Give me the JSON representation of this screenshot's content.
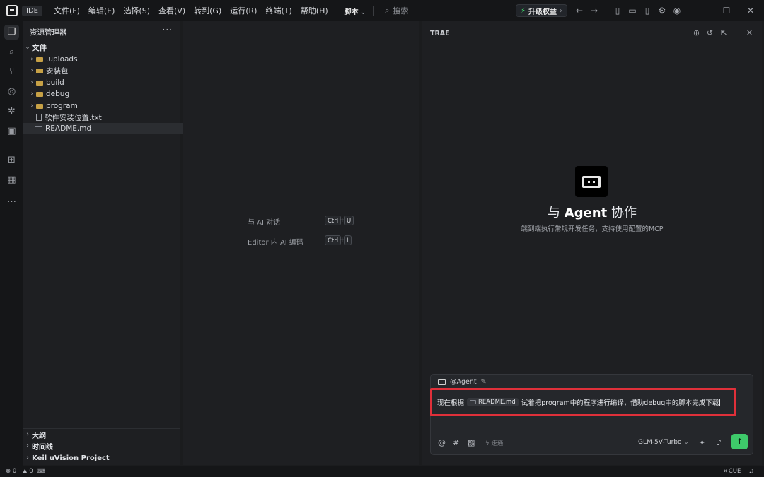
{
  "titlebar": {
    "ide_label": "IDE",
    "menus": [
      "文件(F)",
      "编辑(E)",
      "选择(S)",
      "查看(V)",
      "转到(G)",
      "运行(R)",
      "终端(T)",
      "帮助(H)"
    ],
    "script_label": "脚本",
    "search_placeholder": "搜索",
    "upgrade_label": "升级权益"
  },
  "explorer": {
    "title": "资源管理器",
    "root": "文件",
    "items": [
      {
        "name": ".uploads",
        "type": "folder"
      },
      {
        "name": "安装包",
        "type": "folder"
      },
      {
        "name": "build",
        "type": "folder"
      },
      {
        "name": "debug",
        "type": "folder"
      },
      {
        "name": "program",
        "type": "folder"
      },
      {
        "name": "软件安装位置.txt",
        "type": "file"
      },
      {
        "name": "README.md",
        "type": "md"
      }
    ],
    "sections": [
      "大纲",
      "时间线",
      "Keil uVision Project"
    ]
  },
  "editor": {
    "hints": [
      {
        "label": "与 AI 对话",
        "keys": [
          "Ctrl",
          "U"
        ]
      },
      {
        "label": "Editor 内 AI 编码",
        "keys": [
          "Ctrl",
          "I"
        ]
      }
    ]
  },
  "chat": {
    "panel_title": "TRAE",
    "heading_pre": "与",
    "heading_bold": "Agent",
    "heading_post": "协作",
    "subtitle": "端到端执行常规开发任务，支持使用配置的MCP",
    "agent_chip": "@Agent",
    "message_prefix": "现在根据",
    "message_ref": "README.md",
    "message_suffix": "试着把program中的程序进行编译，借助debug中的脚本完成下载",
    "mode_label": "速通",
    "model_label": "GLM-5V-Turbo"
  },
  "status": {
    "errors": "0",
    "warnings": "0",
    "right_label": "CUE"
  },
  "colors": {
    "accent_green": "#3ec96a",
    "highlight_red": "#e0303a",
    "folder": "#c7a146"
  }
}
